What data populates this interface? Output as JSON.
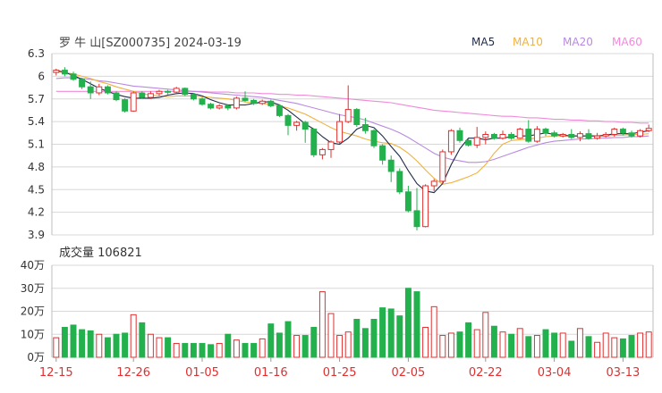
{
  "header": {
    "title": "罗 牛 山[SZ000735] 2024-03-19",
    "legend": [
      {
        "label": "MA5",
        "color": "#1f2a4a"
      },
      {
        "label": "MA10",
        "color": "#f0b240"
      },
      {
        "label": "MA20",
        "color": "#b98ae0"
      },
      {
        "label": "MA60",
        "color": "#f08ad8"
      }
    ]
  },
  "volume_panel": {
    "label": "成交量 106821"
  },
  "colors": {
    "up": "#e03030",
    "down": "#22b14c",
    "grid": "#d8d8d8"
  },
  "chart_data": [
    {
      "type": "candlestick",
      "y_ticks": [
        "6.3",
        "6",
        "5.7",
        "5.4",
        "5.1",
        "4.8",
        "4.5",
        "4.2",
        "3.9"
      ],
      "ylim": [
        3.9,
        6.3
      ],
      "x_tick_labels": [
        "12-15",
        "12-26",
        "01-05",
        "01-16",
        "01-25",
        "02-05",
        "02-22",
        "03-04",
        "03-13"
      ],
      "candles": [
        [
          6.05,
          6.08,
          6.1,
          6.01
        ],
        [
          6.08,
          6.03,
          6.12,
          6.0
        ],
        [
          6.03,
          5.96,
          6.06,
          5.94
        ],
        [
          5.96,
          5.86,
          5.98,
          5.83
        ],
        [
          5.86,
          5.78,
          5.93,
          5.7
        ],
        [
          5.78,
          5.86,
          5.9,
          5.75
        ],
        [
          5.86,
          5.78,
          5.88,
          5.76
        ],
        [
          5.78,
          5.69,
          5.8,
          5.67
        ],
        [
          5.69,
          5.54,
          5.71,
          5.52
        ],
        [
          5.54,
          5.78,
          5.8,
          5.53
        ],
        [
          5.78,
          5.72,
          5.8,
          5.7
        ],
        [
          5.72,
          5.77,
          5.8,
          5.7
        ],
        [
          5.77,
          5.8,
          5.82,
          5.74
        ],
        [
          5.8,
          5.79,
          5.82,
          5.76
        ],
        [
          5.79,
          5.84,
          5.86,
          5.77
        ],
        [
          5.84,
          5.76,
          5.85,
          5.74
        ],
        [
          5.76,
          5.7,
          5.78,
          5.68
        ],
        [
          5.7,
          5.63,
          5.72,
          5.61
        ],
        [
          5.63,
          5.58,
          5.65,
          5.56
        ],
        [
          5.58,
          5.61,
          5.63,
          5.56
        ],
        [
          5.61,
          5.58,
          5.63,
          5.55
        ],
        [
          5.58,
          5.71,
          5.73,
          5.56
        ],
        [
          5.71,
          5.68,
          5.8,
          5.66
        ],
        [
          5.68,
          5.64,
          5.7,
          5.62
        ],
        [
          5.64,
          5.67,
          5.69,
          5.62
        ],
        [
          5.67,
          5.61,
          5.69,
          5.59
        ],
        [
          5.61,
          5.48,
          5.63,
          5.46
        ],
        [
          5.48,
          5.35,
          5.5,
          5.22
        ],
        [
          5.35,
          5.39,
          5.41,
          5.28
        ],
        [
          5.39,
          5.3,
          5.41,
          5.12
        ],
        [
          5.3,
          4.96,
          5.31,
          4.93
        ],
        [
          4.96,
          5.03,
          5.05,
          4.9
        ],
        [
          5.03,
          5.13,
          5.15,
          4.92
        ],
        [
          5.13,
          5.4,
          5.5,
          5.11
        ],
        [
          5.4,
          5.56,
          5.88,
          5.38
        ],
        [
          5.56,
          5.36,
          5.58,
          5.33
        ],
        [
          5.36,
          5.28,
          5.45,
          5.24
        ],
        [
          5.28,
          5.08,
          5.3,
          5.05
        ],
        [
          5.08,
          4.89,
          5.1,
          4.83
        ],
        [
          4.89,
          4.74,
          4.95,
          4.6
        ],
        [
          4.74,
          4.47,
          4.78,
          4.44
        ],
        [
          4.47,
          4.22,
          4.55,
          4.2
        ],
        [
          4.22,
          4.01,
          4.52,
          3.96
        ],
        [
          4.01,
          4.55,
          4.57,
          4.0
        ],
        [
          4.55,
          4.61,
          4.64,
          4.48
        ],
        [
          4.61,
          5.0,
          5.03,
          4.58
        ],
        [
          5.0,
          5.28,
          5.3,
          4.96
        ],
        [
          5.28,
          5.15,
          5.32,
          5.12
        ],
        [
          5.15,
          5.09,
          5.17,
          5.07
        ],
        [
          5.09,
          5.19,
          5.33,
          5.05
        ],
        [
          5.19,
          5.23,
          5.27,
          5.1
        ],
        [
          5.23,
          5.18,
          5.25,
          5.16
        ],
        [
          5.18,
          5.23,
          5.28,
          5.16
        ],
        [
          5.23,
          5.18,
          5.26,
          5.16
        ],
        [
          5.18,
          5.3,
          5.32,
          5.17
        ],
        [
          5.3,
          5.14,
          5.42,
          5.12
        ],
        [
          5.14,
          5.3,
          5.34,
          5.12
        ],
        [
          5.3,
          5.25,
          5.32,
          5.21
        ],
        [
          5.25,
          5.21,
          5.28,
          5.19
        ],
        [
          5.21,
          5.23,
          5.25,
          5.19
        ],
        [
          5.23,
          5.19,
          5.3,
          5.17
        ],
        [
          5.19,
          5.24,
          5.27,
          5.14
        ],
        [
          5.24,
          5.18,
          5.3,
          5.16
        ],
        [
          5.18,
          5.21,
          5.25,
          5.16
        ],
        [
          5.21,
          5.23,
          5.26,
          5.19
        ],
        [
          5.23,
          5.3,
          5.32,
          5.2
        ],
        [
          5.3,
          5.25,
          5.32,
          5.22
        ],
        [
          5.25,
          5.21,
          5.28,
          5.19
        ],
        [
          5.21,
          5.28,
          5.3,
          5.19
        ],
        [
          5.28,
          5.31,
          5.36,
          5.26
        ]
      ],
      "ma5": [
        6.08,
        6.05,
        6.01,
        5.96,
        5.9,
        5.84,
        5.8,
        5.76,
        5.73,
        5.71,
        5.71,
        5.71,
        5.72,
        5.75,
        5.77,
        5.78,
        5.77,
        5.74,
        5.69,
        5.65,
        5.62,
        5.62,
        5.62,
        5.64,
        5.66,
        5.66,
        5.62,
        5.55,
        5.46,
        5.37,
        5.3,
        5.2,
        5.12,
        5.1,
        5.18,
        5.3,
        5.35,
        5.32,
        5.21,
        5.07,
        4.94,
        4.75,
        4.58,
        4.48,
        4.46,
        4.58,
        4.83,
        5.04,
        5.18,
        5.18,
        5.16,
        5.18,
        5.18,
        5.2,
        5.21,
        5.21,
        5.23,
        5.25,
        5.23,
        5.22,
        5.21,
        5.21,
        5.21,
        5.21,
        5.22,
        5.24,
        5.24,
        5.24,
        5.26,
        5.28
      ],
      "ma10": [
        6.06,
        6.05,
        6.03,
        6.0,
        5.97,
        5.93,
        5.9,
        5.86,
        5.83,
        5.8,
        5.77,
        5.75,
        5.74,
        5.73,
        5.74,
        5.74,
        5.74,
        5.73,
        5.72,
        5.71,
        5.7,
        5.68,
        5.66,
        5.65,
        5.64,
        5.63,
        5.61,
        5.58,
        5.54,
        5.5,
        5.44,
        5.38,
        5.32,
        5.27,
        5.24,
        5.21,
        5.17,
        5.14,
        5.12,
        5.11,
        5.06,
        4.98,
        4.88,
        4.76,
        4.65,
        4.57,
        4.59,
        4.63,
        4.67,
        4.72,
        4.83,
        4.98,
        5.1,
        5.15,
        5.16,
        5.17,
        5.18,
        5.2,
        5.21,
        5.21,
        5.21,
        5.21,
        5.21,
        5.21,
        5.21,
        5.22,
        5.22,
        5.23,
        5.23,
        5.24
      ],
      "ma20": [
        5.97,
        5.98,
        5.98,
        5.97,
        5.96,
        5.94,
        5.93,
        5.91,
        5.89,
        5.87,
        5.86,
        5.85,
        5.84,
        5.83,
        5.82,
        5.81,
        5.8,
        5.79,
        5.78,
        5.77,
        5.76,
        5.75,
        5.74,
        5.73,
        5.72,
        5.7,
        5.68,
        5.66,
        5.64,
        5.61,
        5.58,
        5.55,
        5.52,
        5.49,
        5.47,
        5.45,
        5.42,
        5.38,
        5.34,
        5.3,
        5.25,
        5.19,
        5.12,
        5.05,
        4.98,
        4.93,
        4.9,
        4.88,
        4.86,
        4.86,
        4.87,
        4.9,
        4.94,
        4.98,
        5.02,
        5.06,
        5.09,
        5.12,
        5.14,
        5.15,
        5.16,
        5.17,
        5.17,
        5.18,
        5.18,
        5.19,
        5.19,
        5.2,
        5.2,
        5.21
      ],
      "ma60": [
        5.8,
        5.8,
        5.8,
        5.8,
        5.8,
        5.8,
        5.8,
        5.8,
        5.8,
        5.8,
        5.8,
        5.8,
        5.8,
        5.8,
        5.8,
        5.8,
        5.8,
        5.8,
        5.79,
        5.79,
        5.79,
        5.78,
        5.78,
        5.78,
        5.77,
        5.77,
        5.76,
        5.76,
        5.75,
        5.75,
        5.74,
        5.73,
        5.72,
        5.71,
        5.7,
        5.69,
        5.68,
        5.67,
        5.66,
        5.65,
        5.63,
        5.61,
        5.59,
        5.57,
        5.55,
        5.54,
        5.53,
        5.52,
        5.51,
        5.5,
        5.49,
        5.48,
        5.47,
        5.47,
        5.46,
        5.45,
        5.45,
        5.44,
        5.43,
        5.43,
        5.42,
        5.42,
        5.41,
        5.41,
        5.4,
        5.4,
        5.39,
        5.39,
        5.38,
        5.38
      ]
    },
    {
      "type": "bar",
      "y_ticks": [
        "40万",
        "30万",
        "20万",
        "10万",
        "0万"
      ],
      "ylim": [
        0,
        40
      ],
      "unit": "万",
      "values": [
        8.5,
        13,
        14,
        12,
        11.5,
        10,
        8.5,
        10,
        10.5,
        18.5,
        15,
        10,
        8.5,
        8.5,
        6,
        6,
        6,
        6,
        5.5,
        6,
        10,
        7.5,
        6,
        6,
        8,
        14.5,
        10.5,
        15.5,
        9.5,
        9.5,
        13,
        28.5,
        19,
        9.5,
        11,
        16.5,
        12.5,
        16.5,
        21.5,
        21,
        18,
        30,
        28.5,
        13,
        22,
        9.5,
        10.5,
        11,
        15,
        12,
        19.5,
        13.5,
        11,
        10,
        12.5,
        9,
        9.5,
        12,
        10.5,
        10.5,
        7,
        12.5,
        9,
        6.5,
        10.5,
        8.5,
        8,
        9.5,
        10.5,
        11
      ]
    }
  ]
}
